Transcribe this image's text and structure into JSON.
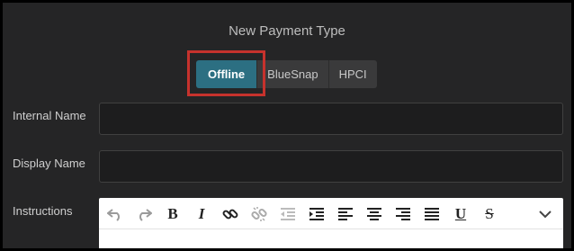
{
  "dialog": {
    "title": "New Payment Type",
    "tabs": [
      {
        "label": "Offline",
        "active": true
      },
      {
        "label": "BlueSnap",
        "active": false
      },
      {
        "label": "HPCI",
        "active": false
      }
    ],
    "fields": {
      "internal_name": {
        "label": "Internal Name",
        "value": ""
      },
      "display_name": {
        "label": "Display Name",
        "value": ""
      },
      "instructions": {
        "label": "Instructions"
      }
    },
    "toolbar": {
      "bold": "B",
      "italic": "I",
      "underline": "U",
      "strike": "S",
      "icons": [
        "undo-icon",
        "redo-icon",
        "bold-icon",
        "italic-icon",
        "link-icon",
        "unlink-icon",
        "outdent-icon",
        "indent-icon",
        "align-left-icon",
        "align-center-icon",
        "align-right-icon",
        "justify-icon",
        "underline-icon",
        "strikethrough-icon",
        "chevron-down-icon"
      ]
    }
  },
  "colors": {
    "background": "#252526",
    "accent": "#2c6f82",
    "highlight": "#c6322d"
  }
}
